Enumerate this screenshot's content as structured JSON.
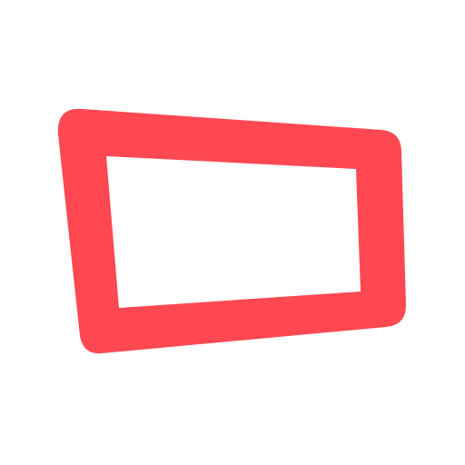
{
  "icon": {
    "name": "quadrilateral-frame-icon",
    "color": "#ff4851",
    "background": "#ffffff"
  }
}
